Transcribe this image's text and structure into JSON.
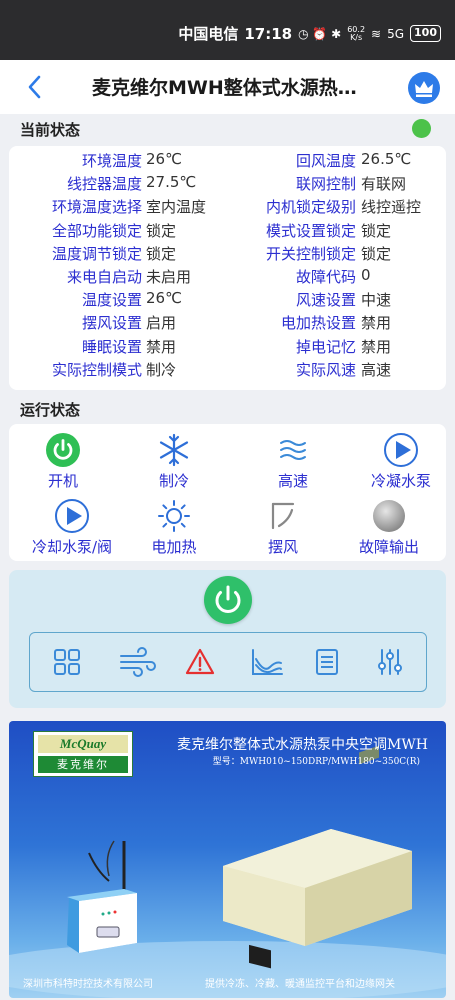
{
  "statusbar": {
    "carrier": "中国电信",
    "time": "17:18",
    "net_speed_value": "60.2",
    "net_speed_unit": "K/s",
    "signal": "5G",
    "battery": "100"
  },
  "header": {
    "title": "麦克维尔MWH整体式水源热…",
    "back_icon": "chevron-left-icon",
    "crown_icon": "crown-icon"
  },
  "current_status": {
    "title": "当前状态",
    "indicator_color": "#4cc24a",
    "rows": [
      {
        "l1": "环境温度",
        "v1": "26℃",
        "l2": "回风温度",
        "v2": "26.5℃"
      },
      {
        "l1": "线控器温度",
        "v1": "27.5℃",
        "l2": "联网控制",
        "v2": "有联网"
      },
      {
        "l1": "环境温度选择",
        "v1": "室内温度",
        "l2": "内机锁定级别",
        "v2": "线控遥控"
      },
      {
        "l1": "全部功能锁定",
        "v1": "锁定",
        "l2": "模式设置锁定",
        "v2": "锁定"
      },
      {
        "l1": "温度调节锁定",
        "v1": "锁定",
        "l2": "开关控制锁定",
        "v2": "锁定"
      },
      {
        "l1": "来电自启动",
        "v1": "未启用",
        "l2": "故障代码",
        "v2": "0"
      },
      {
        "l1": "温度设置",
        "v1": "26℃",
        "l2": "风速设置",
        "v2": "中速"
      },
      {
        "l1": "摆风设置",
        "v1": "启用",
        "l2": "电加热设置",
        "v2": "禁用"
      },
      {
        "l1": "睡眠设置",
        "v1": "禁用",
        "l2": "掉电记忆",
        "v2": "禁用"
      },
      {
        "l1": "实际控制模式",
        "v1": "制冷",
        "l2": "实际风速",
        "v2": "高速"
      }
    ]
  },
  "run_status": {
    "title": "运行状态",
    "items": [
      {
        "label": "开机",
        "icon": "power-on-icon"
      },
      {
        "label": "制冷",
        "icon": "snowflake-icon"
      },
      {
        "label": "高速",
        "icon": "wind-speed-icon"
      },
      {
        "label": "冷凝水泵",
        "icon": "pump-play-icon"
      },
      {
        "label": "冷却水泵/阀",
        "icon": "pump-play-icon"
      },
      {
        "label": "电加热",
        "icon": "sun-heat-icon"
      },
      {
        "label": "摆风",
        "icon": "swing-icon"
      },
      {
        "label": "故障输出",
        "icon": "fault-indicator-icon"
      }
    ]
  },
  "controls": {
    "power_icon": "power-button-icon",
    "tools": [
      "grid-menu-icon",
      "fan-mode-icon",
      "alarm-warning-icon",
      "trend-chart-icon",
      "list-document-icon",
      "settings-sliders-icon"
    ]
  },
  "banner": {
    "brand_top": "McQuay",
    "brand_bottom": "麦克维尔",
    "title": "麦克维尔整体式水源热泵中央空调MWH",
    "model": "型号：MWH010~150DRP/MWH180~350C(R)",
    "footer_left": "深圳市科特时控技术有限公司",
    "footer_right": "提供冷冻、冷藏、暖通监控平台和边缘网关"
  }
}
